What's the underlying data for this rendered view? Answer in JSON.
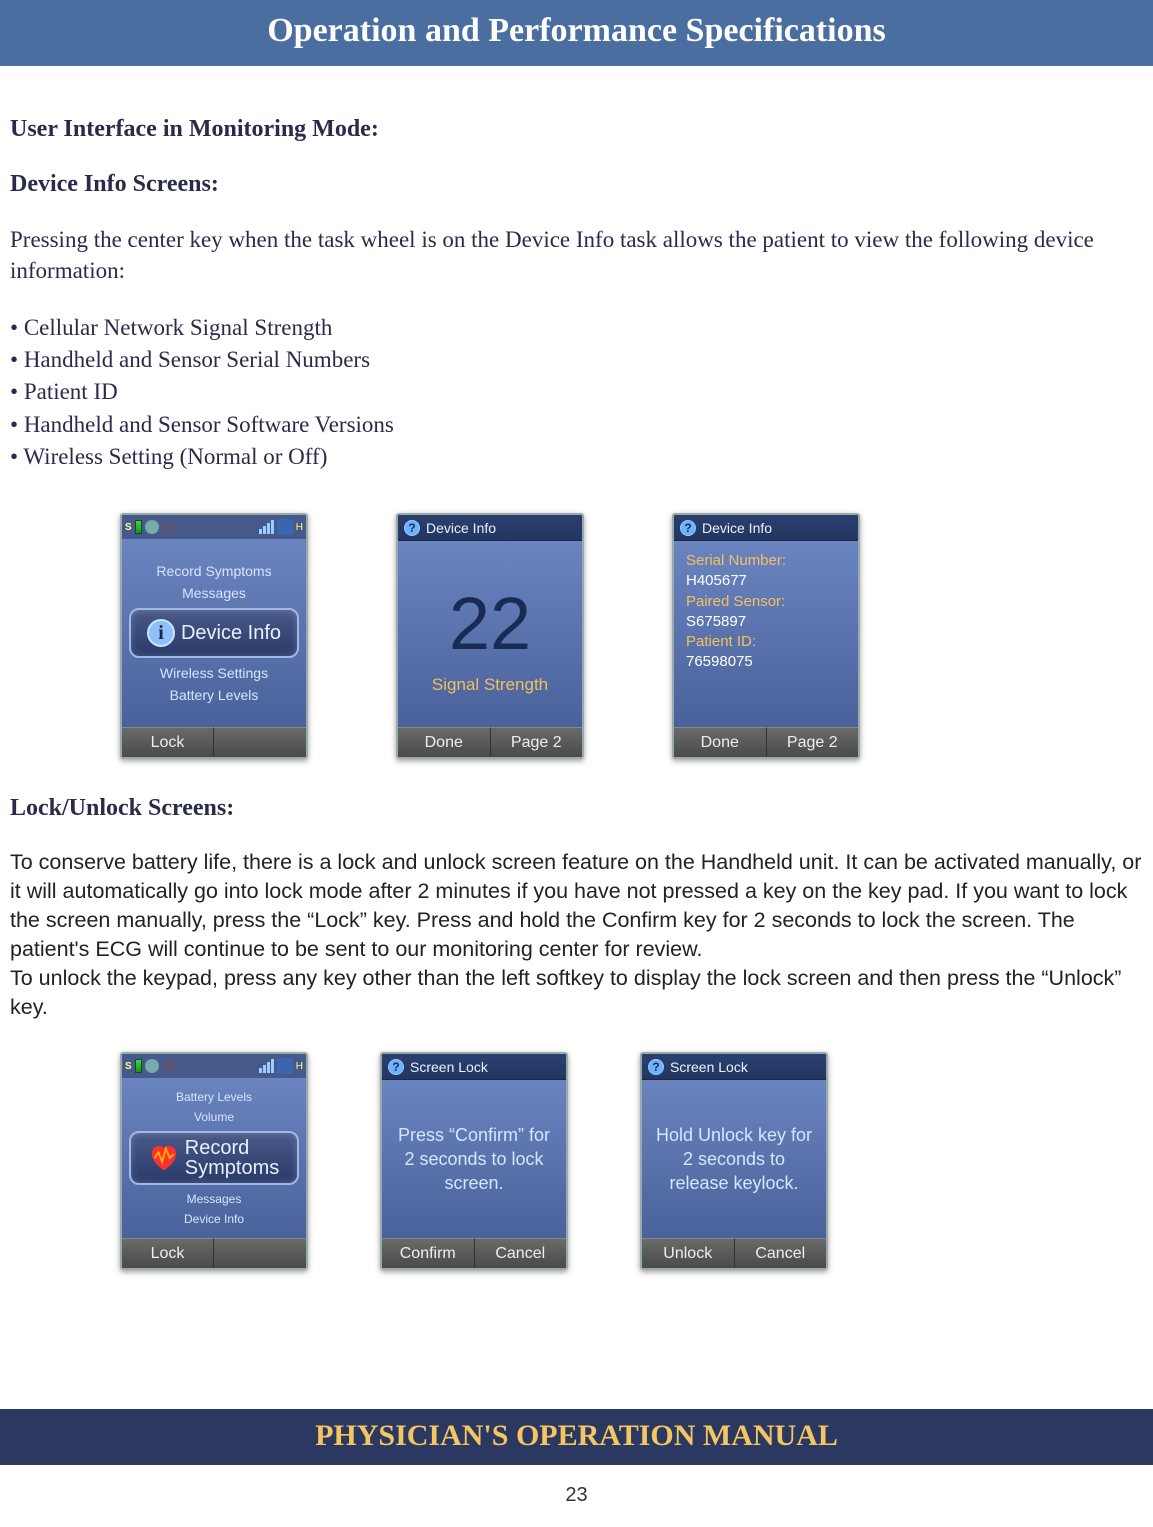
{
  "page": {
    "title": "Operation and Performance Specifications",
    "footer": "PHYSICIAN'S OPERATION MANUAL",
    "number": "23"
  },
  "section1": {
    "heading": "User Interface in Monitoring Mode:",
    "subheading": "Device Info Screens:",
    "intro": "Pressing the center key when the task wheel is on the Device Info task allows the patient to view the following device information:",
    "bullets": [
      "Cellular Network Signal Strength",
      "Handheld and Sensor Serial Numbers",
      "Patient ID",
      "Handheld and Sensor Software Versions",
      "Wireless Setting  (Normal or Off)"
    ]
  },
  "section2": {
    "subheading": "Lock/Unlock Screens:",
    "body": "To conserve battery life, there is a lock and unlock screen feature on the Handheld unit.  It can be activated manually, or it will automatically go into lock mode after 2 minutes if you have not pressed a key on the key pad.  If you want to lock the screen manually, press the “Lock” key.  Press and hold the Confirm key for 2 seconds to lock the screen. The patient's ECG will continue to be sent to our monitoring center for review.\nTo unlock the keypad, press any key other than the left softkey to display the lock screen and then press the “Unlock” key."
  },
  "screens": {
    "deviceInfoWheel": {
      "items": [
        "Record Symptoms",
        "Messages",
        "Device Info",
        "Wireless Settings",
        "Battery Levels"
      ],
      "selected": "Device Info",
      "softkey_left": "Lock"
    },
    "signal": {
      "title": "Device Info",
      "value": "22",
      "label": "Signal Strength",
      "softkey_left": "Done",
      "softkey_right": "Page 2"
    },
    "serials": {
      "title": "Device Info",
      "serial_label": "Serial Number:",
      "serial_value": "H405677",
      "paired_label": "Paired Sensor:",
      "paired_value": "S675897",
      "patient_label": "Patient ID:",
      "patient_value": "76598075",
      "softkey_left": "Done",
      "softkey_right": "Page 2"
    },
    "recordWheel": {
      "items": [
        "Battery Levels",
        "Volume",
        "Record Symptoms",
        "Messages",
        "Device Info"
      ],
      "selected_line1": "Record",
      "selected_line2": "Symptoms",
      "softkey_left": "Lock"
    },
    "lockConfirm": {
      "title": "Screen Lock",
      "msg": "Press “Confirm” for 2 seconds to lock screen.",
      "softkey_left": "Confirm",
      "softkey_right": "Cancel"
    },
    "unlock": {
      "title": "Screen Lock",
      "msg": "Hold Unlock key for 2 seconds to release keylock.",
      "softkey_left": "Unlock",
      "softkey_right": "Cancel"
    }
  }
}
